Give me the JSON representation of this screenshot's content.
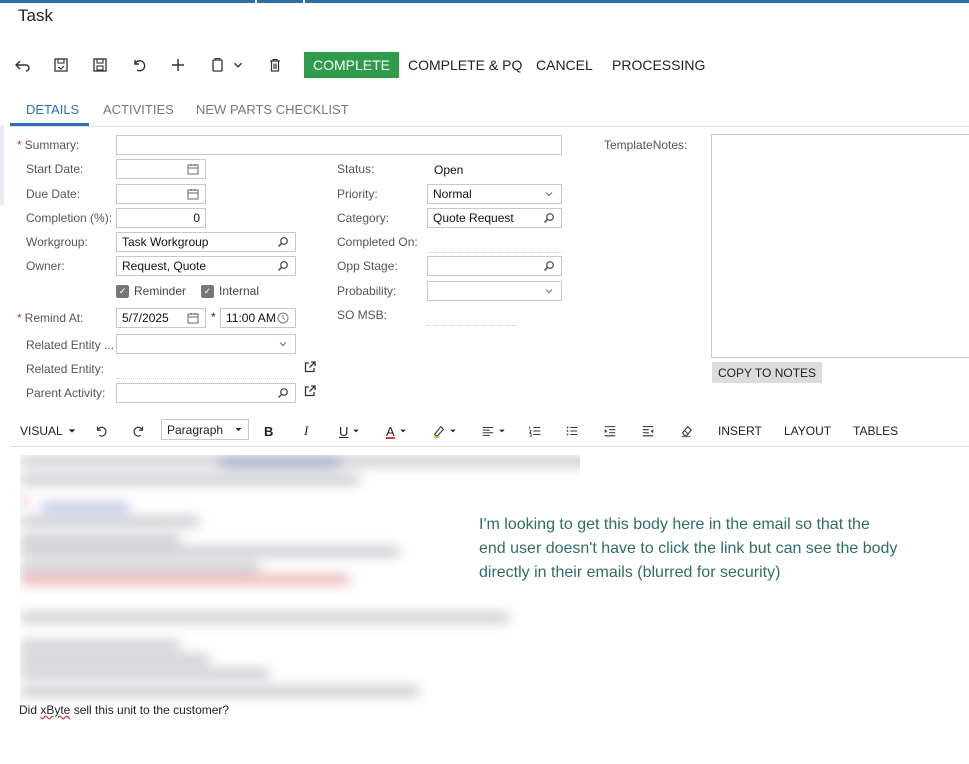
{
  "page": {
    "title": "Task"
  },
  "toolbar": {
    "icons": [
      "back-icon",
      "save-close-icon",
      "save-icon",
      "undo-icon",
      "add-icon",
      "copy-paste-icon",
      "delete-icon"
    ],
    "complete": "COMPLETE",
    "complete_pq": "COMPLETE & PQ",
    "cancel": "CANCEL",
    "processing": "PROCESSING",
    "accent": "#2e9c48"
  },
  "tabs": [
    {
      "label": "DETAILS",
      "active": true
    },
    {
      "label": "ACTIVITIES",
      "active": false
    },
    {
      "label": "NEW PARTS CHECKLIST",
      "active": false
    }
  ],
  "form": {
    "summary": {
      "label": "Summary:",
      "value": ""
    },
    "start_date": {
      "label": "Start Date:",
      "value": ""
    },
    "due_date": {
      "label": "Due Date:",
      "value": ""
    },
    "completion": {
      "label": "Completion (%):",
      "value": "0"
    },
    "workgroup": {
      "label": "Workgroup:",
      "value": "Task Workgroup"
    },
    "owner": {
      "label": "Owner:",
      "value": "Request, Quote"
    },
    "reminder": {
      "label": "Reminder",
      "checked": true
    },
    "internal": {
      "label": "Internal",
      "checked": true
    },
    "remind_at": {
      "label": "Remind At:",
      "date": "5/7/2025",
      "time": "11:00 AM"
    },
    "related_entity_type": {
      "label": "Related Entity ...",
      "value": ""
    },
    "related_entity": {
      "label": "Related Entity:",
      "value": ""
    },
    "parent_activity": {
      "label": "Parent Activity:",
      "value": ""
    },
    "status": {
      "label": "Status:",
      "value": "Open"
    },
    "priority": {
      "label": "Priority:",
      "value": "Normal"
    },
    "category": {
      "label": "Category:",
      "value": "Quote Request"
    },
    "completed_on": {
      "label": "Completed On:",
      "value": ""
    },
    "opp_stage": {
      "label": "Opp Stage:",
      "value": ""
    },
    "probability": {
      "label": "Probability:",
      "value": ""
    },
    "so_msb": {
      "label": "SO MSB:",
      "value": ""
    },
    "template_notes": {
      "label": "TemplateNotes:",
      "value": ""
    },
    "copy_to_notes": "COPY TO NOTES"
  },
  "editor": {
    "visual": "VISUAL",
    "paragraph": "Paragraph",
    "insert": "INSERT",
    "layout": "LAYOUT",
    "tables": "TABLES",
    "last_line_pre": "Did ",
    "last_line_word": "xByte",
    "last_line_post": " sell this unit to the customer?"
  },
  "annotation": "I'm looking to get this body here in the email so that the end user doesn't have to click the link but can see the body directly in their emails (blurred for security)"
}
